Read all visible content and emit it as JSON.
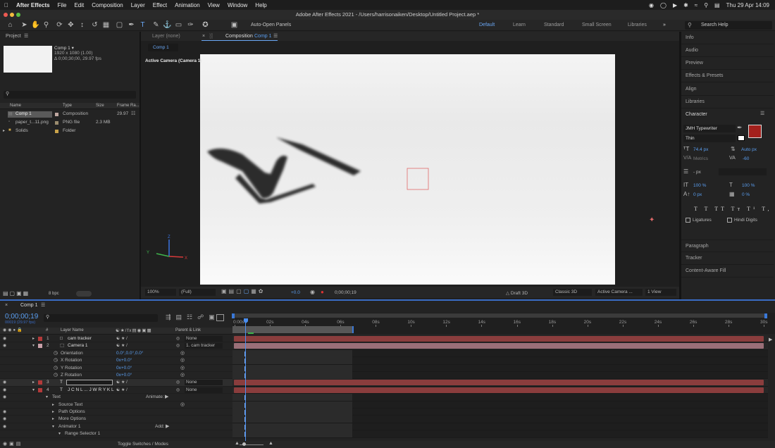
{
  "menubar": {
    "app": "After Effects",
    "items": [
      "File",
      "Edit",
      "Composition",
      "Layer",
      "Effect",
      "Animation",
      "View",
      "Window",
      "Help"
    ],
    "datetime": "Thu 29 Apr  14:09"
  },
  "window_title": "Adobe After Effects 2021 - /Users/harrisonaiken/Desktop/Untitled Project.aep *",
  "toolbar": {
    "auto_open": "Auto-Open Panels",
    "workspaces": [
      "Default",
      "Learn",
      "Standard",
      "Small Screen",
      "Libraries"
    ],
    "search_placeholder": "Search Help"
  },
  "project": {
    "title": "Project",
    "comp_name": "Comp 1 ▾",
    "comp_info1": "1920 x 1080 (1.00)",
    "comp_info2": "Δ 0;00;30;00, 29.97 fps",
    "columns": [
      "Name",
      "Type",
      "Size",
      "Frame Ra..."
    ],
    "items": [
      {
        "name": "Comp 1",
        "type": "Composition",
        "size": "",
        "fps": "29.97"
      },
      {
        "name": "paper_t...11.png",
        "type": "PNG file",
        "size": "2.3 MB",
        "fps": ""
      },
      {
        "name": "Solids",
        "type": "Folder",
        "size": "",
        "fps": ""
      }
    ],
    "bpc": "8 bpc"
  },
  "viewer": {
    "tab_layer": "Layer (none)",
    "tab_comp": "Composition",
    "tab_comp_name": "Comp 1",
    "subtab": "Comp 1",
    "label": "Active Camera (Camera 1)",
    "zoom": "100%",
    "resolution": "(Full)",
    "exposure": "+0.0",
    "timecode": "0;00;00;19",
    "renderer_draft": "Draft 3D",
    "renderer": "Classic 3D",
    "camera": "Active Camera ...",
    "views": "1 View",
    "axis_x": "X",
    "axis_y": "Y",
    "axis_z": "Z"
  },
  "rightpanel": {
    "items_top": [
      "Info",
      "Audio",
      "Preview",
      "Effects & Presets",
      "Align",
      "Libraries"
    ],
    "character": {
      "title": "Character",
      "font": "JMH Typewriter",
      "style": "Thin",
      "size": "74.4 px",
      "leading": "Auto px",
      "kerning": "Metrics",
      "tracking": "-60",
      "stroke": "- px",
      "vscale": "100 %",
      "hscale": "100 %",
      "baseline": "0 px",
      "tsume": "0 %",
      "ligatures": "Ligatures",
      "hindi": "Hindi Digits",
      "fill_color": "#a3201c"
    },
    "items_bottom": [
      "Paragraph",
      "Tracker",
      "Content-Aware Fill"
    ]
  },
  "timeline": {
    "tab": "Comp 1",
    "timecode": "0;00;00;19",
    "fps": "00019 (29.97 fps)",
    "col_layer": "Layer Name",
    "col_parent": "Parent & Link",
    "ticks": [
      "0:00s",
      "02s",
      "04s",
      "06s",
      "08s",
      "10s",
      "12s",
      "14s",
      "16s",
      "18s",
      "20s",
      "22s",
      "24s",
      "26s",
      "28s",
      "30s"
    ],
    "layers": [
      {
        "num": "1",
        "name": "cam tracker",
        "parent": "None",
        "color": "#b33a3a"
      },
      {
        "num": "2",
        "name": "Camera 1",
        "parent": "1. cam tracker",
        "color": "#c8a0a8"
      },
      {
        "num": "",
        "name": "Orientation",
        "value": "0.0°,0.0°,0.0°"
      },
      {
        "num": "",
        "name": "X Rotation",
        "value": "0x+0.0°"
      },
      {
        "num": "",
        "name": "Y Rotation",
        "value": "0x+0.0°"
      },
      {
        "num": "",
        "name": "Z Rotation",
        "value": "0x+0.0°"
      },
      {
        "num": "3",
        "name": "",
        "parent": "None",
        "color": "#b33a3a"
      },
      {
        "num": "4",
        "name": "J C N L ... J W R Y K L",
        "parent": "None",
        "color": "#b33a3a"
      },
      {
        "num": "",
        "name": "Text",
        "value": "Animate:"
      },
      {
        "num": "",
        "name": "Source Text"
      },
      {
        "num": "",
        "name": "Path Options"
      },
      {
        "num": "",
        "name": "More Options"
      },
      {
        "num": "",
        "name": "Animator 1",
        "value": "Add:"
      },
      {
        "num": "",
        "name": "Range Selector 1"
      }
    ],
    "footer": "Toggle Switches / Modes"
  }
}
